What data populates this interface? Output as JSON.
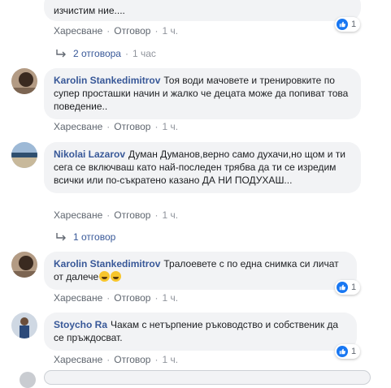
{
  "comments": [
    {
      "id": "c0",
      "author": "",
      "text": "изчистим ние....",
      "actions": {
        "like": "Харесване",
        "reply": "Отговор",
        "time": "1 ч."
      },
      "reactions": "1"
    },
    {
      "id": "c1",
      "author": "Karolin Stankedimitrov",
      "text": "Тоя води мачовете и тренировките по супер просташки начин и жалко че децата може да попиват това поведение..",
      "actions": {
        "like": "Харесване",
        "reply": "Отговор",
        "time": "1 ч."
      }
    },
    {
      "id": "c2",
      "author": "Nikolai Lazarov",
      "text": "Думан Думанов,верно само духачи,но щом и ти сега се включваш като най-последен трябва да ти се изредим всички или по-съкратено казано ДА НИ ПОДУХАШ...",
      "actions": {
        "like": "Харесване",
        "reply": "Отговор",
        "time": "1 ч."
      }
    },
    {
      "id": "c3",
      "author": "Karolin Stankedimitrov",
      "text": "Тралоевете с по една снимка си личат от далече",
      "actions": {
        "like": "Харесване",
        "reply": "Отговор",
        "time": "1 ч."
      },
      "reactions": "1"
    },
    {
      "id": "c4",
      "author": "Stoycho Ra",
      "text": "Чакам с нетърпение ръководство и собственик да се пръждосват.",
      "actions": {
        "like": "Харесване",
        "reply": "Отговор",
        "time": "1 ч."
      },
      "reactions": "1"
    }
  ],
  "reply_links": [
    {
      "label": "2 отговора",
      "time": "1 час"
    },
    {
      "label": "1 отговор"
    }
  ],
  "colors": {
    "link": "#385898",
    "bubble": "#f2f3f5",
    "like": "#1877f2",
    "muted": "#606770"
  }
}
